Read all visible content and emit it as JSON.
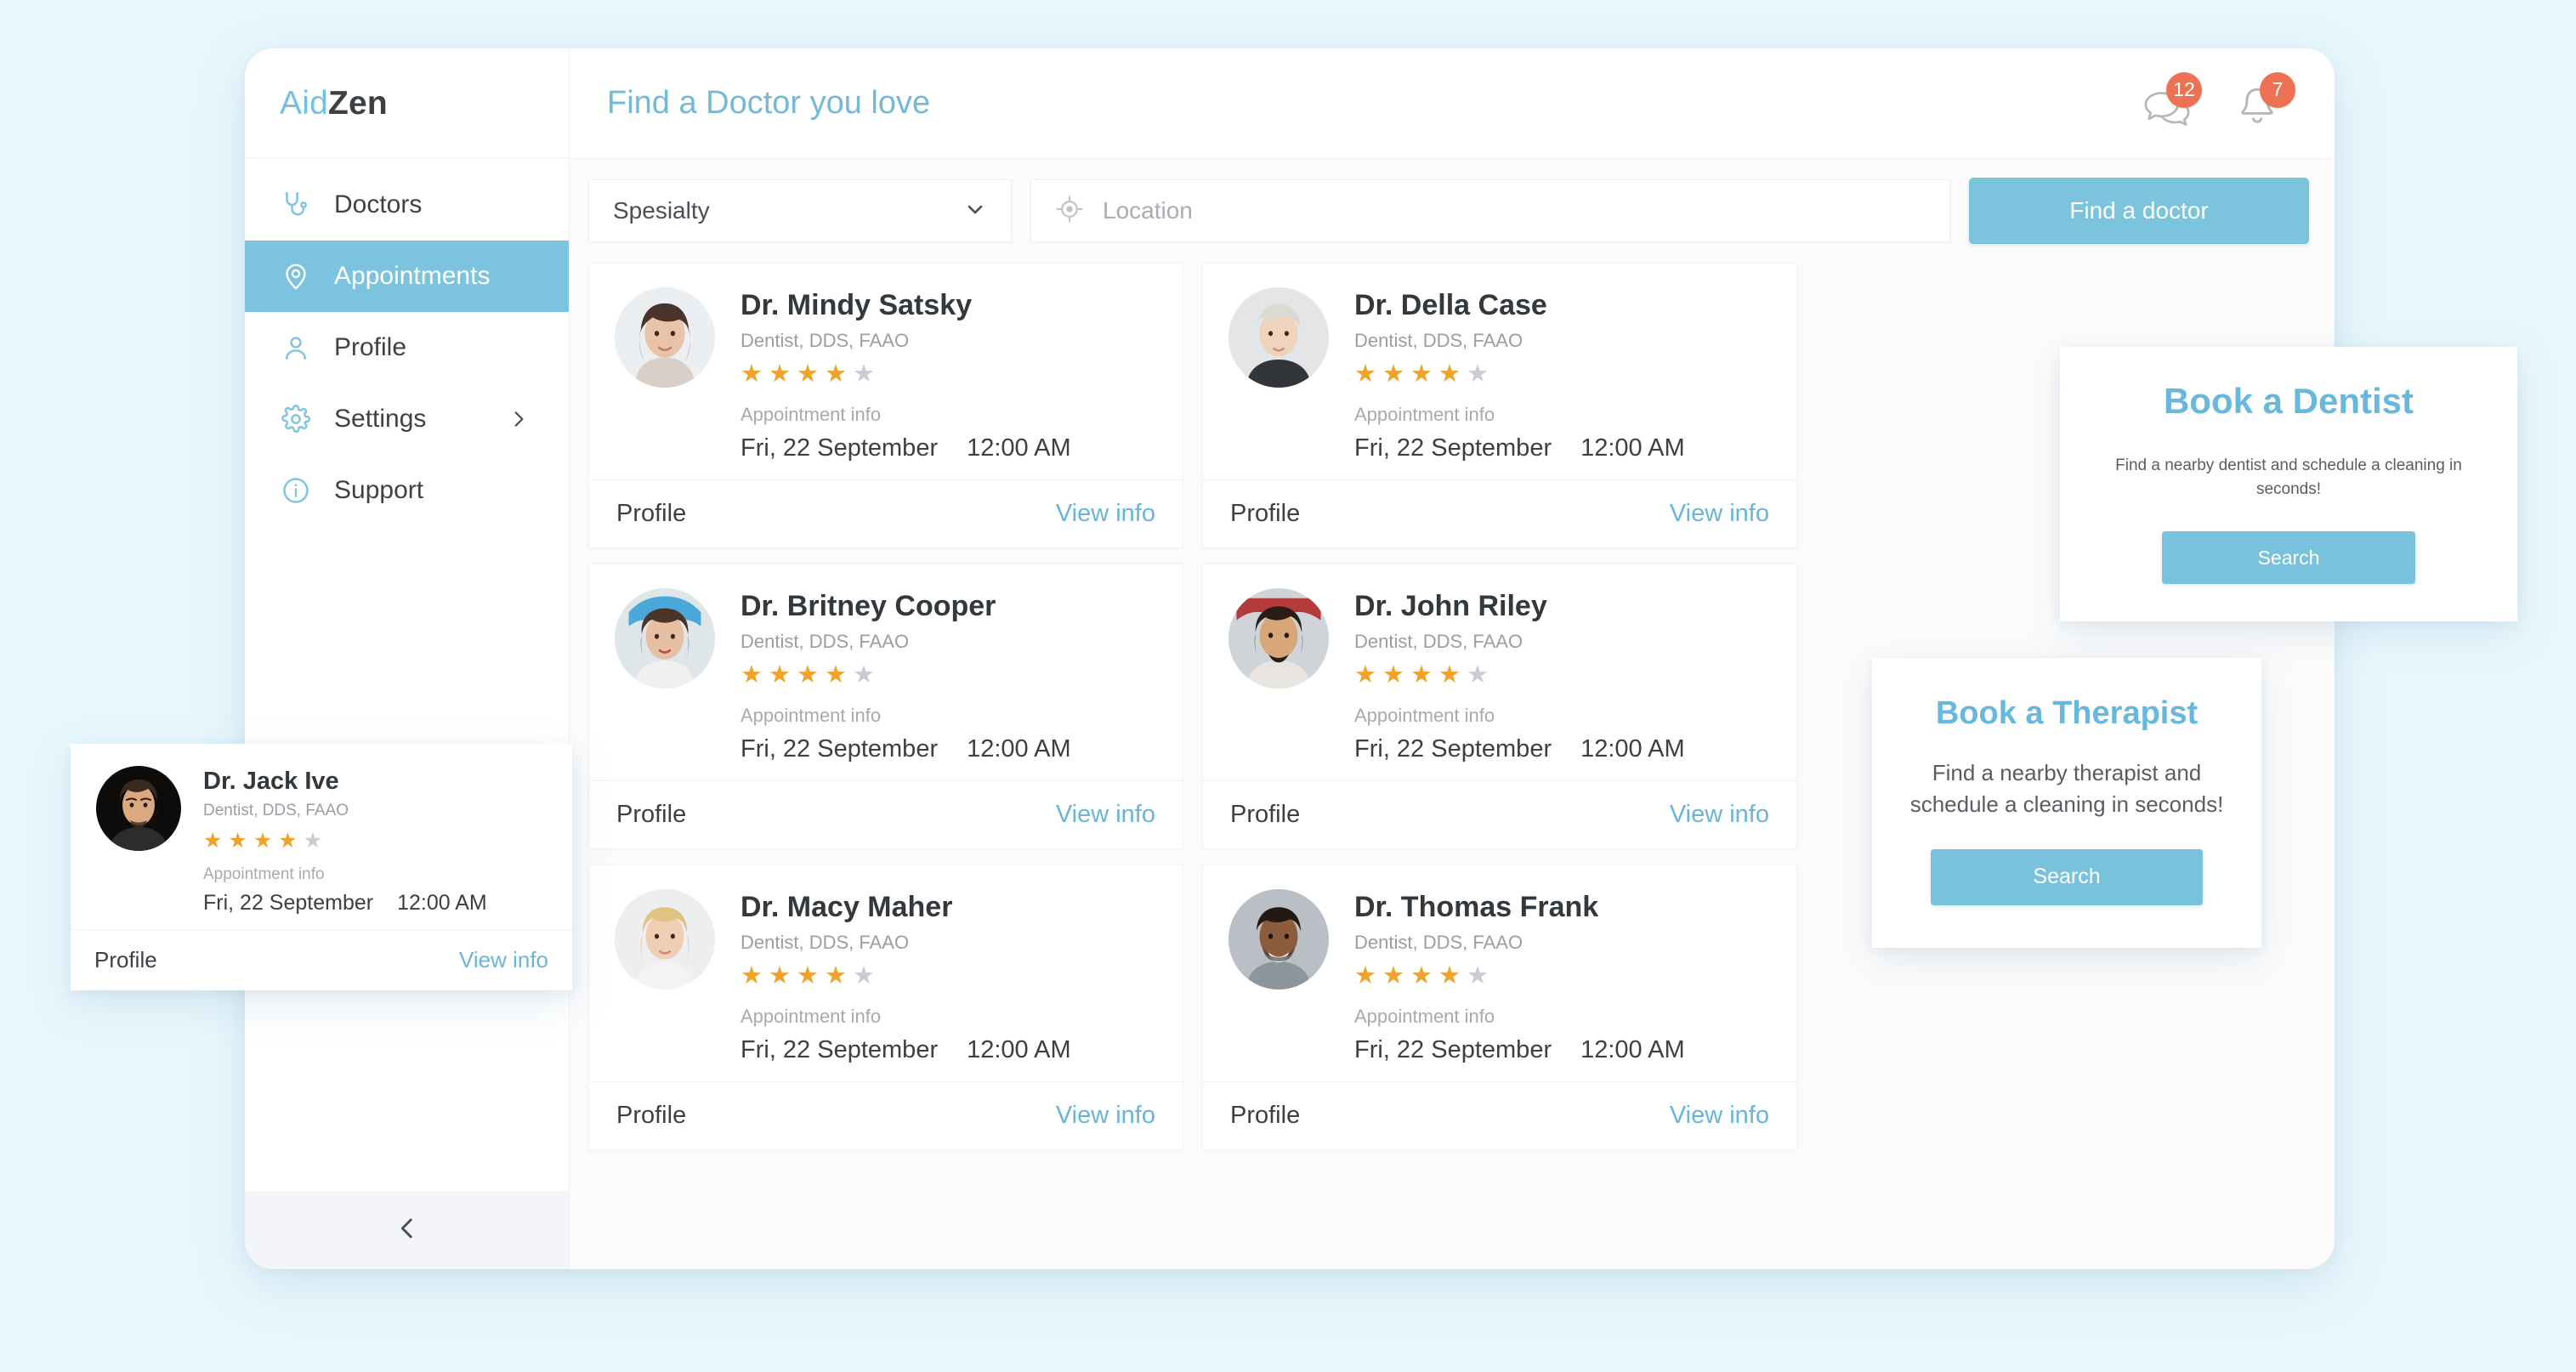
{
  "brand": {
    "part1": "Aid",
    "part2": "Zen"
  },
  "sidebar": {
    "items": [
      {
        "label": "Doctors",
        "icon": "stethoscope-icon",
        "active": false,
        "chevron": false
      },
      {
        "label": "Appointments",
        "icon": "location-pin-icon",
        "active": true,
        "chevron": false
      },
      {
        "label": "Profile",
        "icon": "user-icon",
        "active": false,
        "chevron": false
      },
      {
        "label": "Settings",
        "icon": "gear-icon",
        "active": false,
        "chevron": true
      },
      {
        "label": "Support",
        "icon": "info-circle-icon",
        "active": false,
        "chevron": false
      }
    ],
    "collapse_icon": "chevron-left-icon"
  },
  "header": {
    "title": "Find a Doctor you love",
    "messages": {
      "icon": "chat-bubbles-icon",
      "count": "12"
    },
    "notifications": {
      "icon": "bell-icon",
      "count": "7"
    }
  },
  "filters": {
    "specialty": {
      "value": "Spesialty",
      "icon": "chevron-down-icon"
    },
    "location": {
      "placeholder": "Location",
      "value": "",
      "icon": "crosshair-target-icon"
    },
    "submit_label": "Find a doctor"
  },
  "card_labels": {
    "appointment_info": "Appointment info",
    "profile": "Profile",
    "view_info": "View info"
  },
  "doctors": [
    {
      "name": "Dr. Mindy Satsky",
      "specialty": "Dentist, DDS, FAAO",
      "rating": 4,
      "max_rating": 5,
      "date": "Fri, 22 September",
      "time": "12:00 AM"
    },
    {
      "name": "Dr. Della Case",
      "specialty": "Dentist, DDS, FAAO",
      "rating": 4,
      "max_rating": 5,
      "date": "Fri, 22 September",
      "time": "12:00 AM"
    },
    {
      "name": "Dr. Britney Cooper",
      "specialty": "Dentist, DDS, FAAO",
      "rating": 4,
      "max_rating": 5,
      "date": "Fri, 22 September",
      "time": "12:00 AM"
    },
    {
      "name": "Dr. John Riley",
      "specialty": "Dentist, DDS, FAAO",
      "rating": 4,
      "max_rating": 5,
      "date": "Fri, 22 September",
      "time": "12:00 AM"
    },
    {
      "name": "Dr. Macy Maher",
      "specialty": "Dentist, DDS, FAAO",
      "rating": 4,
      "max_rating": 5,
      "date": "Fri, 22 September",
      "time": "12:00 AM"
    },
    {
      "name": "Dr. Thomas Frank",
      "specialty": "Dentist, DDS, FAAO",
      "rating": 4,
      "max_rating": 5,
      "date": "Fri, 22 September",
      "time": "12:00 AM"
    }
  ],
  "floating_doctor": {
    "name": "Dr. Jack Ive",
    "specialty": "Dentist, DDS, FAAO",
    "rating": 4,
    "max_rating": 5,
    "date": "Fri, 22 September",
    "time": "12:00 AM"
  },
  "promos": [
    {
      "title": "Book a Dentist",
      "description": "Find a nearby dentist and schedule a cleaning in seconds!",
      "button": "Search"
    },
    {
      "title": "Book a Therapist",
      "description": "Find a nearby therapist and schedule a cleaning in seconds!",
      "button": "Search"
    }
  ],
  "colors": {
    "accent": "#7bc3de",
    "title": "#74b9d6",
    "badge": "#ed7254",
    "star_on": "#f0a32a",
    "star_off": "#c9ccd1",
    "page_bg": "#e9f7fd"
  }
}
